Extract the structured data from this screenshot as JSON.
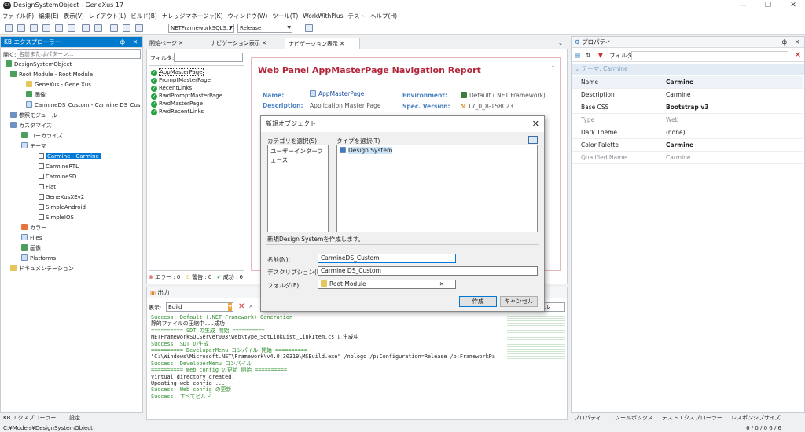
{
  "window": {
    "logo": "GX",
    "title": "DesignSystemObject - GeneXus 17",
    "controls": [
      "—",
      "❐",
      "✕"
    ]
  },
  "menu": [
    "ファイル(F)",
    "編集(E)",
    "表示(V)",
    "レイアウト(L)",
    "ビルド(B)",
    "ナレッジマネージャ(K)",
    "ウィンドウ(W)",
    "ツール(T)",
    "WorkWithPlus",
    "テスト",
    "ヘルプ(H)"
  ],
  "toolbar": {
    "environment": "NETFrameworkSQLS...",
    "configuration": "Release"
  },
  "kb_explorer": {
    "title": "KB エクスプローラー",
    "search_placeholder": "名前またはパターン...",
    "search_label": "開く:",
    "tree": [
      "DesignSystemObject",
      "Root Module - Root Module",
      "GeneXus - Gene Xus",
      "画像",
      "CarmineDS_Custom - Carmine DS_Cus",
      "参照モジュール",
      "カスタマイズ",
      "ローカライズ",
      "テーマ",
      "Carmine - Carmine",
      "CarmineRTL",
      "CarmineSD",
      "Flat",
      "GeneXusXEv2",
      "SimpleAndroid",
      "SimpleIOS",
      "カラー",
      "Files",
      "画像",
      "Platforms",
      "ドキュメンテーション"
    ],
    "bottom_tabs": [
      "KB エクスプローラー",
      "設定"
    ]
  },
  "doc_tabs": [
    "開始ページ",
    "ナビゲーション表示",
    "ナビゲーション表示"
  ],
  "nav_view": {
    "filter_label": "フィルタ:",
    "items": [
      "AppMasterPage",
      "PromptMasterPage",
      "RecentLinks",
      "RwdPromptMasterPage",
      "RwdMasterPage",
      "RwdRecentLinks"
    ],
    "errors": "エラー : 0",
    "warnings": "警告 : 0",
    "success": "成功 : 6",
    "report": {
      "title": "Web Panel AppMasterPage Navigation Report",
      "name_label": "Name:",
      "name_value": "AppMasterPage",
      "desc_label": "Description:",
      "desc_value": "Application Master Page",
      "env_label": "Environment:",
      "env_value": "Default (.NET Framework)",
      "spec_label": "Spec. Version:",
      "spec_value": "17_0_8-158023"
    }
  },
  "dialog": {
    "title": "新規オブジェクト",
    "category_label": "カテゴリを選択(S):",
    "category_item": "ユーザーインターフェース",
    "type_label": "タイプを選択(T)",
    "type_item": "Design System",
    "description": "新規Design Systemを作成します。",
    "name_label": "名前(N):",
    "name_value": "CarmineDS_Custom",
    "desc_label": "デスクリプション(D):",
    "desc_value": "Carmine DS_Custom",
    "folder_label": "フォルダ(F):",
    "folder_value": "Root Module",
    "create_button": "作成",
    "cancel_button": "キャンセル"
  },
  "output": {
    "title": "出力",
    "show_label": "表示:",
    "show_value": "Build",
    "scroll_button": "スクロール",
    "lines": [
      {
        "text": "Success: Default (.NET Framework) Generation",
        "color": "#2c8c2c"
      },
      {
        "text": "静的ファイルの圧縮中...成功",
        "color": "#222222"
      },
      {
        "text": "========== SDT の生成 開始 ==========",
        "color": "#2c8c2c"
      },
      {
        "text": "NETFrameworkSQLServer003\\web\\type_SdtLinkList_LinkItem.cs に生成中",
        "color": "#222222"
      },
      {
        "text": "Success: SDT の生成",
        "color": "#2c8c2c"
      },
      {
        "text": "========== DeveloperMenu コンパイル 開始 ==========",
        "color": "#2c8c2c"
      },
      {
        "text": "\"C:\\Windows\\Microsoft.NET\\Framework\\v4.0.30319\\MSBuild.exe\" /nologo /p:Configuration=Release /p:FrameworkPa",
        "color": "#222222"
      },
      {
        "text": "Success: DeveloperMenu コンパイル",
        "color": "#2c8c2c"
      },
      {
        "text": "========== Web config の更新 開始 ==========",
        "color": "#2c8c2c"
      },
      {
        "text": "Virtual directory created.",
        "color": "#222222"
      },
      {
        "text": "Updating web config ...",
        "color": "#222222"
      },
      {
        "text": "Success: Web config の更新",
        "color": "#2c8c2c"
      },
      {
        "text": "Success: すべてビルド",
        "color": "#2c8c2c"
      }
    ]
  },
  "properties": {
    "title": "プロパティ",
    "filter_label": "フィルタ",
    "category": "テーマ: Carmine",
    "rows": [
      {
        "key": "Name",
        "value": "Carmine",
        "bold": true,
        "dim": false
      },
      {
        "key": "Description",
        "value": "Carmine",
        "bold": false,
        "dim": false
      },
      {
        "key": "Base CSS",
        "value": "Bootstrap v3",
        "bold": true,
        "dim": false
      },
      {
        "key": "Type",
        "value": "Web",
        "bold": false,
        "dim": true
      },
      {
        "key": "Dark Theme",
        "value": "(none)",
        "bold": false,
        "dim": false
      },
      {
        "key": "Color Palette",
        "value": "Carmine",
        "bold": true,
        "dim": false
      },
      {
        "key": "Qualified Name",
        "value": "Carmine",
        "bold": false,
        "dim": true
      }
    ],
    "bottom_tabs": [
      "プロパティ",
      "ツールボックス",
      "テストエクスプローラー",
      "レスポンシブサイズ"
    ]
  },
  "status": {
    "path": "C:¥Models¥DesignSystemObject",
    "counts": "6 / 0 / 0 6 / 6"
  },
  "colors": {
    "accent": "#007acc",
    "report_title": "#b3263a",
    "success": "#2c8c2c"
  }
}
